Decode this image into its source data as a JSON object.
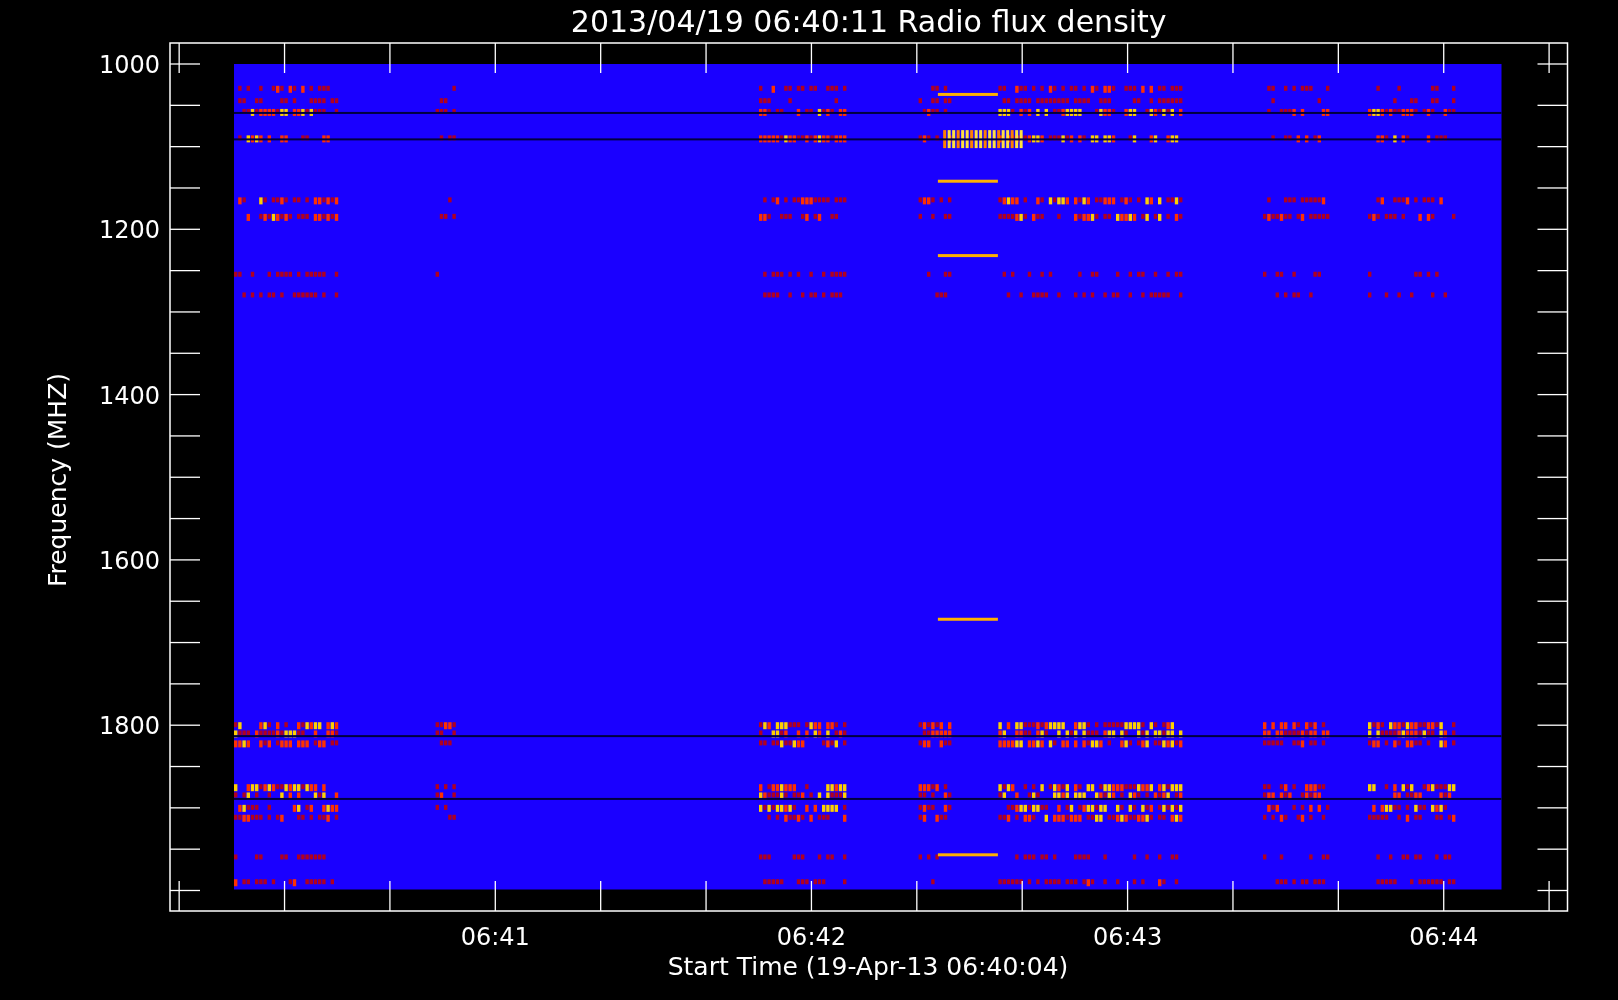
{
  "title": "2013/04/19 06:40:11 Radio flux density",
  "y_axis": {
    "label": "Frequency (MHZ)",
    "ticks": [
      "1000",
      "1200",
      "1400",
      "1600",
      "1800"
    ]
  },
  "x_axis": {
    "label": "Start Time (19-Apr-13 06:40:04)",
    "ticks": [
      "06:41",
      "06:42",
      "06:43",
      "06:44"
    ]
  }
}
